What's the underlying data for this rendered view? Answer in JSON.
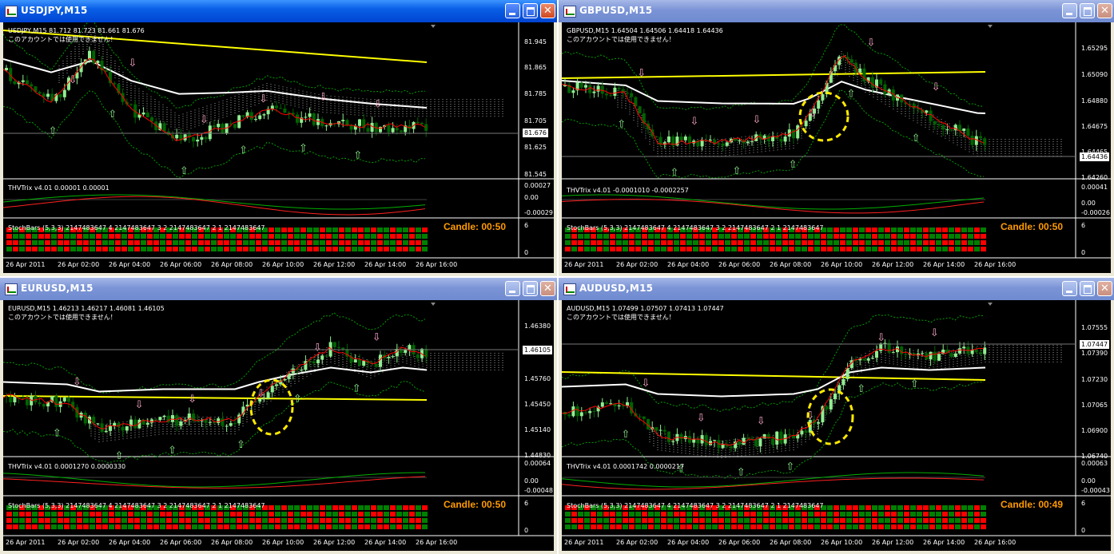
{
  "windows": [
    {
      "title": "USDJPY,M15",
      "info_line": "USDJPY,M15  81.712 81.723 81.661 81.676",
      "notice": "このアカウントでは使用できません！",
      "current_price": "81.676",
      "price_ticks": [
        "81.945",
        "81.865",
        "81.785",
        "81.705",
        "81.625",
        "81.545"
      ],
      "trix_title": "THVTrix v4.01 0.00001 0.00001",
      "trix_ticks": [
        "0.00027",
        "0.00",
        "-0.00029"
      ],
      "stoch_title": "StochBars (5,3,3) 2147483647 4 2147483647 3 2 2147483647 2 1 2147483647",
      "stoch_ticks": [
        "6",
        "0"
      ],
      "candle_label": "Candle:  00:50",
      "time_labels": [
        "26 Apr 2011",
        "26 Apr 02:00",
        "26 Apr 04:00",
        "26 Apr 06:00",
        "26 Apr 08:00",
        "26 Apr 10:00",
        "26 Apr 12:00",
        "26 Apr 14:00",
        "26 Apr 16:00"
      ],
      "active": true
    },
    {
      "title": "GBPUSD,M15",
      "info_line": "GBPUSD,M15  1.64504 1.64506 1.64418 1.64436",
      "notice": "このアカウントでは使用できません！",
      "current_price": "1.64436",
      "price_ticks": [
        "1.65295",
        "1.65090",
        "1.64880",
        "1.64675",
        "1.64465",
        "1.64260"
      ],
      "trix_title": "THVTrix v4.01 -0.0001010 -0.0002257",
      "trix_ticks": [
        "0.00041",
        "0.00",
        "-0.00026"
      ],
      "stoch_title": "StochBars (5,3,3) 2147483647 4 2147483647 3 2 2147483647 2 1 2147483647",
      "stoch_ticks": [
        "6",
        "0"
      ],
      "candle_label": "Candle:  00:50",
      "time_labels": [
        "26 Apr 2011",
        "26 Apr 02:00",
        "26 Apr 04:00",
        "26 Apr 06:00",
        "26 Apr 08:00",
        "26 Apr 10:00",
        "26 Apr 12:00",
        "26 Apr 14:00",
        "26 Apr 16:00"
      ],
      "active": false
    },
    {
      "title": "EURUSD,M15",
      "info_line": "EURUSD,M15  1.46213 1.46217 1.46081 1.46105",
      "notice": "このアカウントでは使用できません！",
      "current_price": "1.46105",
      "price_ticks": [
        "1.46380",
        "1.46105",
        "1.45760",
        "1.45450",
        "1.45140",
        "1.44830"
      ],
      "trix_title": "THVTrix v4.01 0.0001270 0.0000330",
      "trix_ticks": [
        "0.00064",
        "0.00",
        "-0.00048"
      ],
      "stoch_title": "StochBars (5,3,3) 2147483647 4 2147483647 3 2 2147483647 2 1 2147483647",
      "stoch_ticks": [
        "6",
        "0"
      ],
      "candle_label": "Candle:  00:50",
      "time_labels": [
        "26 Apr 2011",
        "26 Apr 02:00",
        "26 Apr 04:00",
        "26 Apr 06:00",
        "26 Apr 08:00",
        "26 Apr 10:00",
        "26 Apr 12:00",
        "26 Apr 14:00",
        "26 Apr 16:00"
      ],
      "active": false
    },
    {
      "title": "AUDUSD,M15",
      "info_line": "AUDUSD,M15  1.07499 1.07507 1.07413 1.07447",
      "notice": "このアカウントでは使用できません！",
      "current_price": "1.07447",
      "price_ticks": [
        "1.07555",
        "1.07390",
        "1.07230",
        "1.07065",
        "1.06900",
        "1.06740"
      ],
      "trix_title": "THVTrix v4.01 0.0001742 0.0000217",
      "trix_ticks": [
        "0.00063",
        "0.00",
        "-0.00043"
      ],
      "stoch_title": "StochBars (5,3,3) 2147483647 4 2147483647 3 2 2147483647 2 1 2147483647",
      "stoch_ticks": [
        "6",
        "0"
      ],
      "candle_label": "Candle:  00:49",
      "time_labels": [
        "26 Apr 2011",
        "26 Apr 02:00",
        "26 Apr 04:00",
        "26 Apr 06:00",
        "26 Apr 08:00",
        "26 Apr 10:00",
        "26 Apr 12:00",
        "26 Apr 14:00",
        "26 Apr 16:00"
      ],
      "active": false
    }
  ],
  "colors": {
    "background": "#000000",
    "bull_candle": "#90ee90",
    "bear_candle": "#006400",
    "ma_red": "#ff0000",
    "ma_yellow": "#ffff00",
    "ma_white": "#ffffff",
    "bands": "#00a000",
    "candle_timer": "#ff9b00",
    "stoch_red": "#ff0000",
    "stoch_green": "#008000"
  },
  "chart_data": [
    {
      "type": "line",
      "symbol": "USDJPY",
      "timeframe": "M15",
      "ylim": [
        81.545,
        81.945
      ],
      "last": 81.676,
      "x": [
        "26 Apr 2011",
        "26 Apr 02:00",
        "26 Apr 04:00",
        "26 Apr 06:00",
        "26 Apr 08:00",
        "26 Apr 10:00",
        "26 Apr 12:00",
        "26 Apr 14:00",
        "26 Apr 16:00"
      ]
    },
    {
      "type": "line",
      "symbol": "GBPUSD",
      "timeframe": "M15",
      "ylim": [
        1.6426,
        1.65295
      ],
      "last": 1.64436,
      "x": [
        "26 Apr 2011",
        "26 Apr 02:00",
        "26 Apr 04:00",
        "26 Apr 06:00",
        "26 Apr 08:00",
        "26 Apr 10:00",
        "26 Apr 12:00",
        "26 Apr 14:00",
        "26 Apr 16:00"
      ]
    },
    {
      "type": "line",
      "symbol": "EURUSD",
      "timeframe": "M15",
      "ylim": [
        1.4483,
        1.4638
      ],
      "last": 1.46105,
      "x": [
        "26 Apr 2011",
        "26 Apr 02:00",
        "26 Apr 04:00",
        "26 Apr 06:00",
        "26 Apr 08:00",
        "26 Apr 10:00",
        "26 Apr 12:00",
        "26 Apr 14:00",
        "26 Apr 16:00"
      ]
    },
    {
      "type": "line",
      "symbol": "AUDUSD",
      "timeframe": "M15",
      "ylim": [
        1.0674,
        1.07555
      ],
      "last": 1.07447,
      "x": [
        "26 Apr 2011",
        "26 Apr 02:00",
        "26 Apr 04:00",
        "26 Apr 06:00",
        "26 Apr 08:00",
        "26 Apr 10:00",
        "26 Apr 12:00",
        "26 Apr 14:00",
        "26 Apr 16:00"
      ]
    }
  ]
}
